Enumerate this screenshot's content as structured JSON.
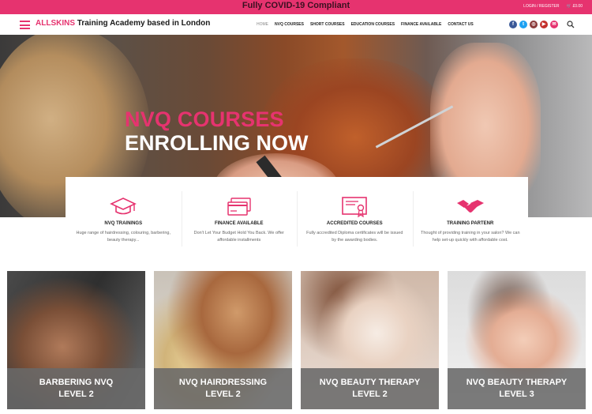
{
  "topbar": {
    "announcement": "Fully COVID-19 Compliant",
    "login": "LOGIN / REGISTER",
    "cart": "£0.00"
  },
  "header": {
    "brand_accent": "ALLSKINS",
    "brand_rest": " Training Academy based in London",
    "nav": [
      "HOME",
      "NVQ COURSES",
      "SHORT COURSES",
      "EDUCATION COURSES",
      "FINANCE AVAILABLE",
      "CONTACT US"
    ],
    "social_icons": [
      "facebook-icon",
      "twitter-icon",
      "instagram-icon",
      "youtube-icon",
      "email-icon"
    ],
    "social_colors": [
      "#3b5998",
      "#1da1f2",
      "#8a3a3a",
      "#c4302b",
      "#e6336f"
    ]
  },
  "hero": {
    "line1": "NVQ COURSES",
    "line2": "ENROLLING NOW"
  },
  "features": [
    {
      "icon": "graduation-cap-icon",
      "title": "NVQ TRAININGS",
      "desc": "Huge range of hairdressing, colouring, barbering, beauty therapy..."
    },
    {
      "icon": "credit-card-icon",
      "title": "FINANCE AVAILABLE",
      "desc": "Don't Let Your Budget Hold You Back. We offer affordable installments"
    },
    {
      "icon": "certificate-icon",
      "title": "ACCREDITED COURSES",
      "desc": "Fully accredited Diploma certificates will be issued by the awarding bodies."
    },
    {
      "icon": "handshake-icon",
      "title": "TRAINING PARTENR",
      "desc": "Thought of providing training in your salon? We can help set-up quickly with affordable cost."
    }
  ],
  "courses": [
    {
      "line1": "BARBERING NVQ",
      "line2": "LEVEL 2"
    },
    {
      "line1": "NVQ HAIRDRESSING",
      "line2": "LEVEL 2"
    },
    {
      "line1": "NVQ BEAUTY THERAPY",
      "line2": "LEVEL 2"
    },
    {
      "line1": "NVQ BEAUTY THERAPY",
      "line2": "LEVEL 3"
    }
  ],
  "colors": {
    "accent": "#e6336f",
    "card_overlay": "#696969"
  }
}
